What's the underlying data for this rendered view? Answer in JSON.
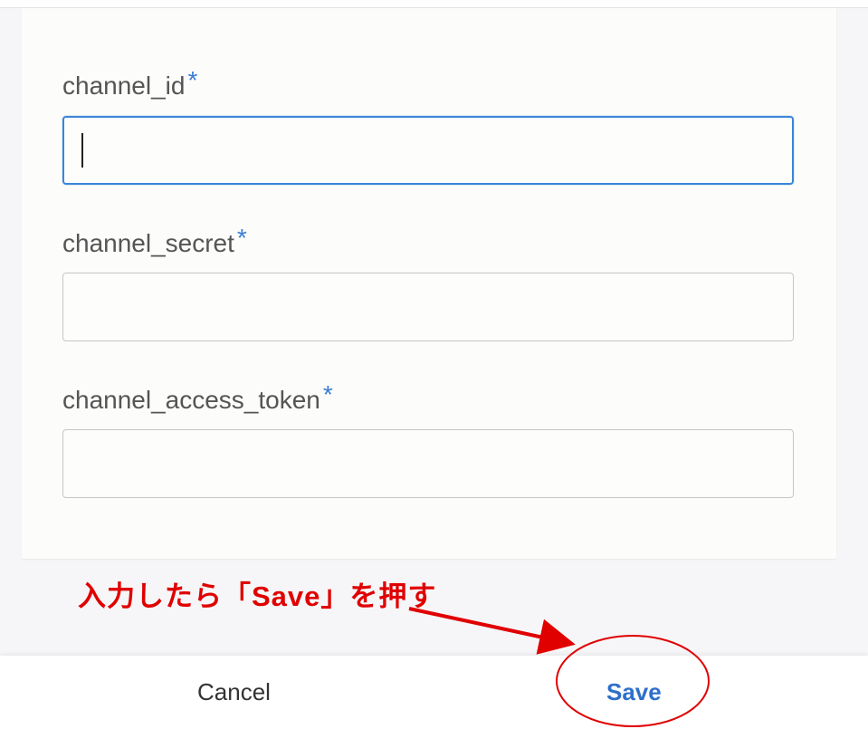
{
  "form": {
    "fields": [
      {
        "label": "channel_id",
        "required_mark": "*",
        "value": ""
      },
      {
        "label": "channel_secret",
        "required_mark": "*",
        "value": ""
      },
      {
        "label": "channel_access_token",
        "required_mark": "*",
        "value": ""
      }
    ]
  },
  "annotation": {
    "text": "入力したら「Save」を押す",
    "color": "#e00000"
  },
  "footer": {
    "cancel_label": "Cancel",
    "save_label": "Save"
  },
  "colors": {
    "accent": "#3a86d8",
    "required": "#3a7bd5",
    "save_text": "#2f6fcb"
  }
}
